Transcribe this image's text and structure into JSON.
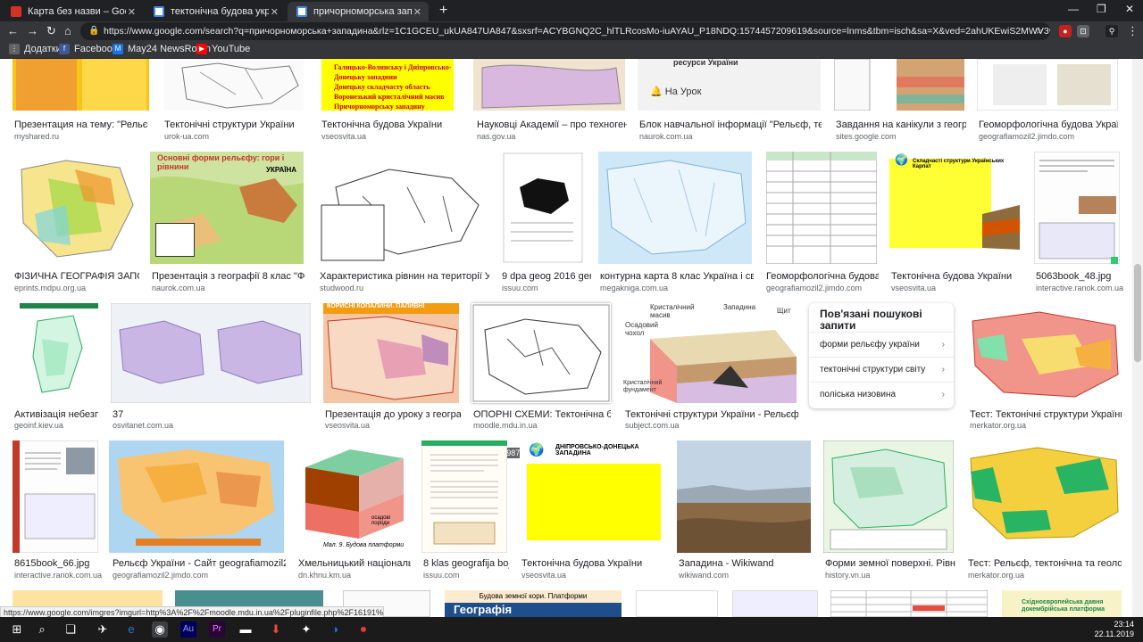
{
  "tabs": [
    {
      "title": "Карта без назви – Google Мої карти",
      "color": "#d93025"
    },
    {
      "title": "тектонічна будова україни - Пошук Google",
      "color": "#4285f4"
    },
    {
      "title": "причорноморська западина - Пошук Google",
      "color": "#4285f4"
    }
  ],
  "url": "https://www.google.com/search?q=причорноморська+западина&rlz=1C1GCEU_ukUA847UA847&sxsrf=ACYBGNQ2C_hlTLRcosMo-iuAYAU_P18NDQ:1574457209619&source=lnms&tbm=isch&sa=X&ved=2ahUKEwiS2MWV3v7IAhVJxosKHaqbBRcQ_...",
  "bookmarks": [
    {
      "label": "Додатки",
      "color": "#5f6368",
      "glyph": "⋮"
    },
    {
      "label": "Facebook",
      "color": "#3b5998",
      "glyph": "f"
    },
    {
      "label": "May24 NewsRoom",
      "color": "#1a73e8",
      "glyph": "M"
    },
    {
      "label": "YouTube",
      "color": "#ff0000",
      "glyph": "▶"
    }
  ],
  "row0": [
    {
      "caption": "Презентация на тему: \"Рельєф. Тект...",
      "source": "myshared.ru"
    },
    {
      "caption": "Тектонічні структури України",
      "source": "urok-ua.com"
    },
    {
      "caption": "Тектонічна будова України",
      "source": "vseosvita.ua"
    },
    {
      "caption": "Науковці Академії – про техногенні впли...",
      "source": "nas.gov.ua"
    },
    {
      "caption": "Блок навчальної інформації \"Рельєф, тектонічні с...",
      "source": "naurok.com.ua"
    },
    {
      "caption": "Завдання на канікули з географії ...",
      "source": "sites.google.com"
    },
    {
      "caption": "Геоморфологічна будова України - Са...",
      "source": "geografiamozil2.jimdo.com"
    }
  ],
  "row0_texts": {
    "t1": "Галицько-Волинську і Дніпровсько-Донецьку западини",
    "t2": "Донецьку складчасту область",
    "t3": "Воронезький кристалічний масив",
    "t4": "Причорноморську западину",
    "t5": "ресурси України",
    "t6": "На Урок"
  },
  "row1": [
    {
      "caption": "ФІЗИЧНА ГЕОГРАФІЯ ЗАПОРІЗЬК...",
      "source": "eprints.mdpu.org.ua"
    },
    {
      "caption": "Презентація з географії 8 клас \"Форми з...",
      "source": "naurok.com.ua"
    },
    {
      "caption": "Характеристика рівнин на території України - ...",
      "source": "studwood.ru"
    },
    {
      "caption": "9 dpa geog 2016 gene...",
      "source": "issuu.com"
    },
    {
      "caption": "контурна карта 8 клас Україна і світове г...",
      "source": "megakniga.com.ua"
    },
    {
      "caption": "Геоморфологічна будова Укр...",
      "source": "geografiamozil2.jimdo.com"
    },
    {
      "caption": "Тектонічна будова України",
      "source": "vseosvita.ua"
    },
    {
      "caption": "5063book_48.jpg",
      "source": "interactive.ranok.com.ua"
    }
  ],
  "row1_texts": {
    "forms_title": "Основні форми рельєфу: гори і рівнини",
    "ukraina": "УКРАЇНА",
    "carpathian": "Складчасті структури Українських Карпат"
  },
  "row2": [
    {
      "caption": "Активізація небезпеч...",
      "source": "geoinf.kiev.ua"
    },
    {
      "caption": "37",
      "source": "osvitanet.com.ua"
    },
    {
      "caption": "Презентація до уроку з географії у ...",
      "source": "vseosvita.ua"
    },
    {
      "caption": "ОПОРНІ СХЕМИ: Тектонічна будова р...",
      "source": "moodle.mdu.in.ua"
    },
    {
      "caption": "Тектонічні структури України - Рельєф, тектоні...",
      "source": "subject.com.ua"
    },
    {
      "caption": "Тест: Тектонічні структури України | MER...",
      "source": "merkator.org.ua"
    }
  ],
  "row2_texts": {
    "minerals": "КОРИСНІ КОПАЛИНИ. ПАЛИВНІ",
    "dims": "2773 × 1987",
    "crystal": "Кристалічний масив",
    "depression": "Западина",
    "shield": "Щит",
    "cover": "Осадовий чохол",
    "foundation": "Кристалічний фундамент"
  },
  "related": {
    "title": "Пов'язані пошукові запити",
    "items": [
      "форми рельєфу україни",
      "тектонічні структури світу",
      "поліська низовина"
    ]
  },
  "row3": [
    {
      "caption": "8615book_66.jpg",
      "source": "interactive.ranok.com.ua"
    },
    {
      "caption": "Рельєф України - Сайт geografiamozil2!",
      "source": "geografiamozil2.jimdo.com"
    },
    {
      "caption": "Хмельницький національни...",
      "source": "dn.khnu.km.ua"
    },
    {
      "caption": "8 klas geografija bojko...",
      "source": "issuu.com"
    },
    {
      "caption": "Тектонічна будова України",
      "source": "vseosvita.ua"
    },
    {
      "caption": "Западина - Wikiwand",
      "source": "wikiwand.com"
    },
    {
      "caption": "Форми земної поверхні. Рівнини - ...",
      "source": "history.vn.ua"
    },
    {
      "caption": "Тест: Рельєф, тектонічна та геологічна бу...",
      "source": "merkator.org.ua"
    }
  ],
  "row3_texts": {
    "dnipro": "ДНІПРОВСЬКО-ДОНЕЦЬКА ЗАПАДИНА",
    "platform_caption": "Мал. 9. Будова платформи",
    "sediment": "осадові породи"
  },
  "row4_texts": {
    "platform": "Будова земної кори. Платформи",
    "geo": "Географія",
    "east": "Східноєвропейська давня докембрійська платформа"
  },
  "status_url": "https://www.google.com/imgres?imgurl=http%3A%2F%2Fmoodle.mdu.in.ua%2Fpluginfile.php%2F16191%2Fmod_bo...",
  "clock": {
    "time": "23:14",
    "date": "22.11.2019"
  },
  "colors": {
    "yellow": "#ffff00",
    "accent": "#1a73e8"
  }
}
